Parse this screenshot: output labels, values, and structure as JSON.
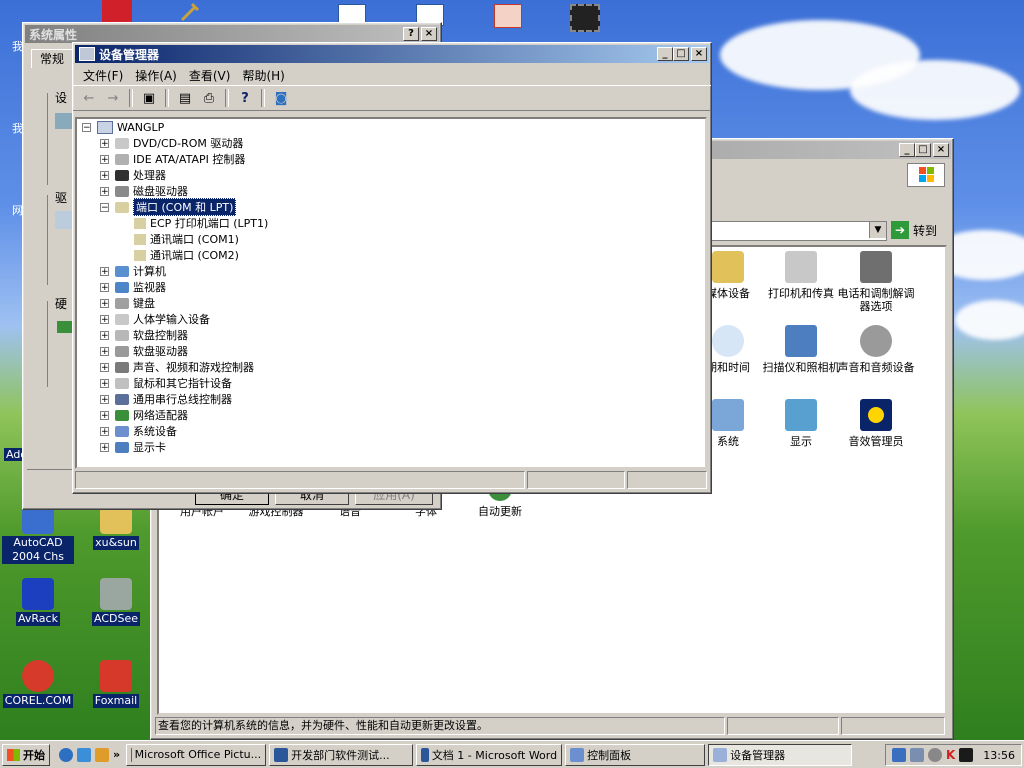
{
  "desktop": {
    "icons": [
      {
        "label": "AutoCAD 2004 Chs",
        "color": "#3a6fd0"
      },
      {
        "label": "xu&sun",
        "color": "#e2c15a"
      },
      {
        "label": "AvRack",
        "color": "#1c3fbf"
      },
      {
        "label": "ACDSee",
        "color": "#9aa7a0"
      },
      {
        "label": "COREL.COM",
        "color": "#d53a2a"
      },
      {
        "label": "Foxmail",
        "color": "#d6392a"
      }
    ],
    "partial_labels": {
      "left1": "我",
      "left2": "我",
      "left3": "网",
      "left4": "Ado"
    }
  },
  "sys_props": {
    "title": "系统属性",
    "tab_general": "常规",
    "group_labels": [
      "设",
      "驱",
      "硬"
    ],
    "buttons": {
      "ok": "确定",
      "cancel": "取消",
      "apply": "应用(A)"
    }
  },
  "devmgr": {
    "title": "设备管理器",
    "menu": [
      "文件(F)",
      "操作(A)",
      "查看(V)",
      "帮助(H)"
    ],
    "root": "WANGLP",
    "items": [
      {
        "label": "DVD/CD-ROM 驱动器",
        "icon": "cdrom-icon",
        "expanded": false
      },
      {
        "label": "IDE ATA/ATAPI 控制器",
        "icon": "ide-icon",
        "expanded": false
      },
      {
        "label": "处理器",
        "icon": "cpu-icon",
        "expanded": false
      },
      {
        "label": "磁盘驱动器",
        "icon": "disk-icon",
        "expanded": false
      },
      {
        "label": "端口 (COM 和 LPT)",
        "icon": "port-icon",
        "expanded": true,
        "selected": true,
        "children": [
          "ECP 打印机端口 (LPT1)",
          "通讯端口 (COM1)",
          "通讯端口 (COM2)"
        ]
      },
      {
        "label": "计算机",
        "icon": "computer-icon",
        "expanded": false
      },
      {
        "label": "监视器",
        "icon": "monitor-icon",
        "expanded": false
      },
      {
        "label": "键盘",
        "icon": "keyboard-icon",
        "expanded": false
      },
      {
        "label": "人体学输入设备",
        "icon": "hid-icon",
        "expanded": false
      },
      {
        "label": "软盘控制器",
        "icon": "floppy-ctrl-icon",
        "expanded": false
      },
      {
        "label": "软盘驱动器",
        "icon": "floppy-icon",
        "expanded": false
      },
      {
        "label": "声音、视频和游戏控制器",
        "icon": "sound-icon",
        "expanded": false
      },
      {
        "label": "鼠标和其它指针设备",
        "icon": "mouse-icon",
        "expanded": false
      },
      {
        "label": "通用串行总线控制器",
        "icon": "usb-icon",
        "expanded": false
      },
      {
        "label": "网络适配器",
        "icon": "network-icon",
        "expanded": false
      },
      {
        "label": "系统设备",
        "icon": "system-icon",
        "expanded": false
      },
      {
        "label": "显示卡",
        "icon": "display-icon",
        "expanded": false
      }
    ]
  },
  "control_panel": {
    "go_label": "转到",
    "items": [
      {
        "label": "媒体设备",
        "icon": "media-icon"
      },
      {
        "label": "打印机和传真",
        "icon": "printer-icon"
      },
      {
        "label": "电话和调制解调器选项",
        "icon": "phone-icon"
      },
      {
        "label": "期和时间",
        "icon": "clock-icon"
      },
      {
        "label": "扫描仪和照相机",
        "icon": "scanner-icon"
      },
      {
        "label": "声音和音频设备",
        "icon": "speaker-icon"
      },
      {
        "label": "系统",
        "icon": "system-icon"
      },
      {
        "label": "显示",
        "icon": "display-icon"
      },
      {
        "label": "音效管理员",
        "icon": "sound-manager-icon"
      },
      {
        "label": "用户帐户",
        "icon": "users-icon"
      },
      {
        "label": "游戏控制器",
        "icon": "game-icon"
      },
      {
        "label": "语音",
        "icon": "speech-icon"
      },
      {
        "label": "字体",
        "icon": "font-icon"
      },
      {
        "label": "自动更新",
        "icon": "update-icon"
      }
    ],
    "status": "查看您的计算机系统的信息，并为硬件、性能和自动更新更改设置。"
  },
  "taskbar": {
    "start": "开始",
    "tasks": [
      "Microsoft Office Pictu...",
      "开发部门软件测试...",
      "文档 1 - Microsoft Word",
      "控制面板",
      "设备管理器"
    ],
    "active_task": "设备管理器",
    "clock": "13:56"
  },
  "colors": {
    "title_active": "#0a246a",
    "title_inactive": "#808080",
    "face": "#d4d0c8"
  }
}
